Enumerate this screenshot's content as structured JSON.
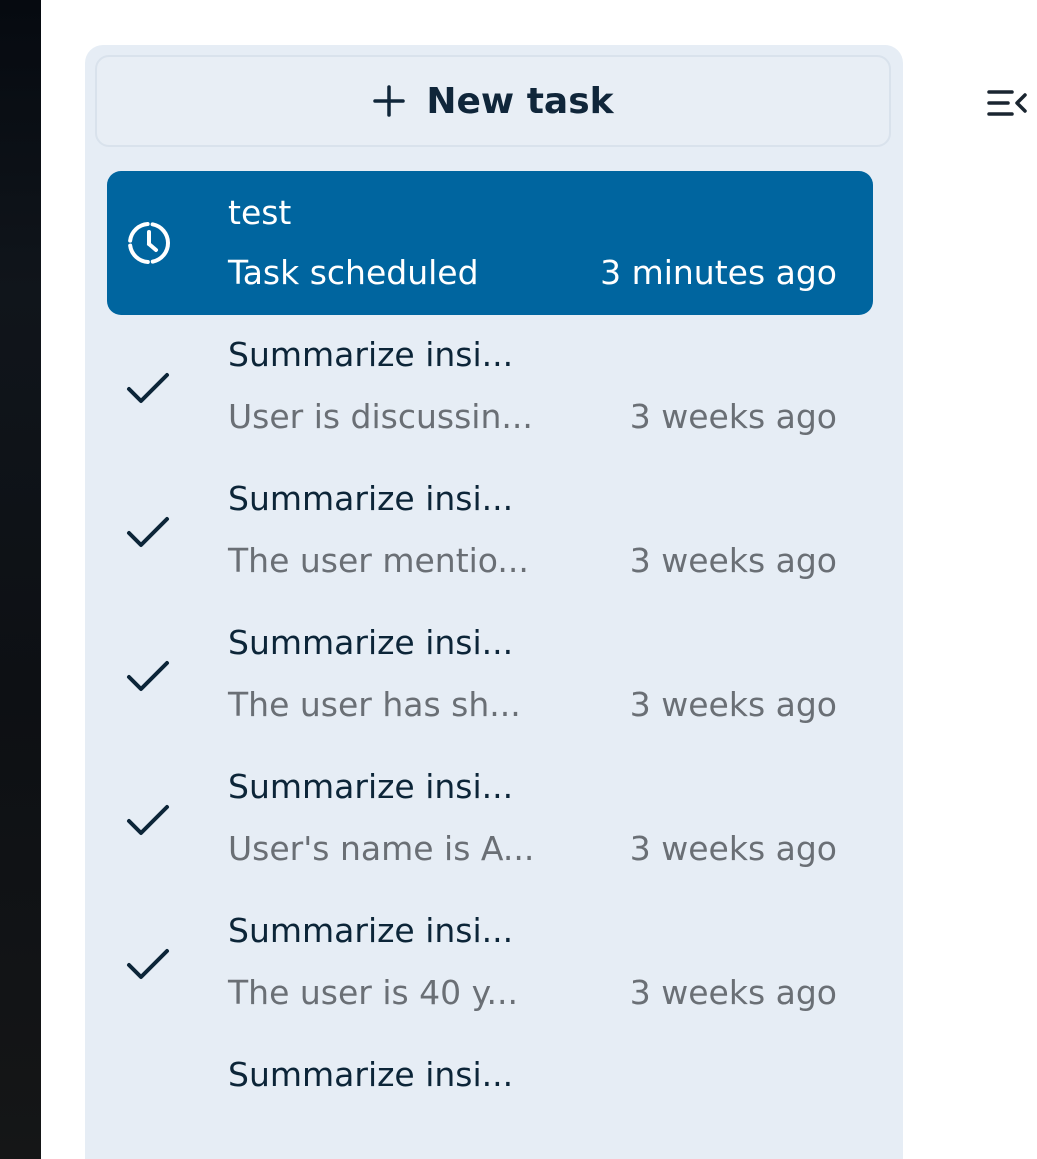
{
  "sidebar": {
    "new_task_label": "New task",
    "collapse_icon": "collapse-sidebar-icon",
    "tasks": [
      {
        "title": "test",
        "subtitle": "Task scheduled",
        "time": "3 minutes ago",
        "status": "scheduled",
        "active": true
      },
      {
        "title": "Summarize insi...",
        "subtitle": "User is discussin...",
        "time": "3 weeks ago",
        "status": "completed"
      },
      {
        "title": "Summarize insi...",
        "subtitle": "The user mentio...",
        "time": "3 weeks ago",
        "status": "completed"
      },
      {
        "title": "Summarize insi...",
        "subtitle": "The user has sh...",
        "time": "3 weeks ago",
        "status": "completed"
      },
      {
        "title": "Summarize insi...",
        "subtitle": "User's name is A...",
        "time": "3 weeks ago",
        "status": "completed"
      },
      {
        "title": "Summarize insi...",
        "subtitle": "The user is 40 y...",
        "time": "3 weeks ago",
        "status": "completed"
      },
      {
        "title": "Summarize insi...",
        "subtitle": "",
        "time": "",
        "status": "completed"
      }
    ]
  },
  "colors": {
    "active_item_bg": "#00659f",
    "panel_bg": "#e6edf5",
    "title_text": "#0c2538",
    "secondary_text": "#6a6f75"
  }
}
